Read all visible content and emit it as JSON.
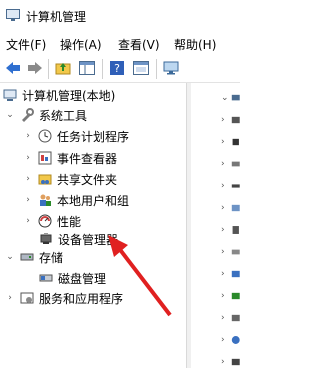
{
  "window": {
    "title": "计算机管理"
  },
  "menu": [
    {
      "label": "文件(F)"
    },
    {
      "label": "操作(A)"
    },
    {
      "label": "查看(V)"
    },
    {
      "label": "帮助(H)"
    }
  ],
  "tree": {
    "root": "计算机管理(本地)",
    "system_tools": "系统工具",
    "task_scheduler": "任务计划程序",
    "event_viewer": "事件查看器",
    "shared_folders": "共享文件夹",
    "local_users": "本地用户和组",
    "performance": "性能",
    "device_manager": "设备管理器",
    "storage": "存储",
    "disk_management": "磁盘管理",
    "services_apps": "服务和应用程序"
  },
  "colors": {
    "arrow": "#e02020",
    "accent": "#0a64d8"
  }
}
